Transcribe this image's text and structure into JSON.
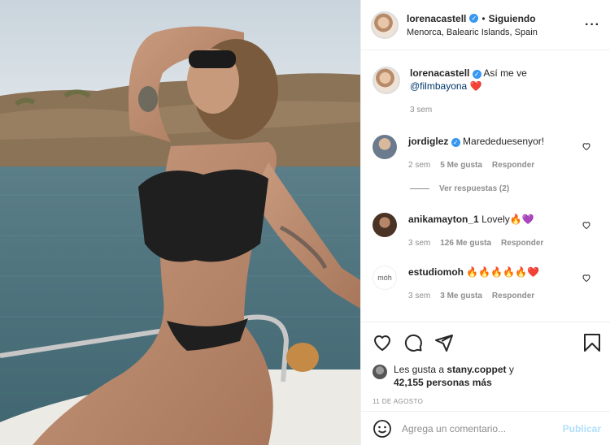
{
  "header": {
    "username": "lorenacastell",
    "verified_glyph": "✓",
    "separator": "•",
    "follow_state": "Siguiendo",
    "location": "Menorca, Balearic Islands, Spain",
    "more_glyph": "···"
  },
  "caption": {
    "username": "lorenacastell",
    "text": "Así me ve",
    "mention": "@filmbayona",
    "emoji": "❤️",
    "time": "3 sem"
  },
  "comments": [
    {
      "username": "jordiglez",
      "verified": true,
      "text": "Marededuesenyor!",
      "time": "2 sem",
      "likes": "5 Me gusta",
      "reply": "Responder",
      "view_replies": "Ver respuestas (2)"
    },
    {
      "username": "anikamayton_1",
      "verified": false,
      "text": "Lovely🔥💜",
      "time": "3 sem",
      "likes": "126 Me gusta",
      "reply": "Responder"
    },
    {
      "username": "estudiomoh",
      "verified": false,
      "avatar_text": "mȯh",
      "text": "🔥🔥🔥🔥🔥❤️",
      "time": "3 sem",
      "likes": "3 Me gusta",
      "reply": "Responder"
    }
  ],
  "likes": {
    "prefix": "Les gusta a",
    "user": "stany.coppet",
    "connector": "y",
    "count": "42,155 personas más"
  },
  "date": "11 DE AGOSTO",
  "add_comment": {
    "placeholder": "Agrega un comentario...",
    "publish": "Publicar"
  },
  "colors": {
    "verified": "#3897f0",
    "link": "#00376b",
    "muted": "#8e8e8e",
    "publish": "#b2dffc",
    "heart": "#ed4956"
  },
  "icons": [
    "heart-icon",
    "comment-icon",
    "share-icon",
    "bookmark-icon",
    "emoji-icon",
    "more-icon",
    "verified-icon"
  ]
}
